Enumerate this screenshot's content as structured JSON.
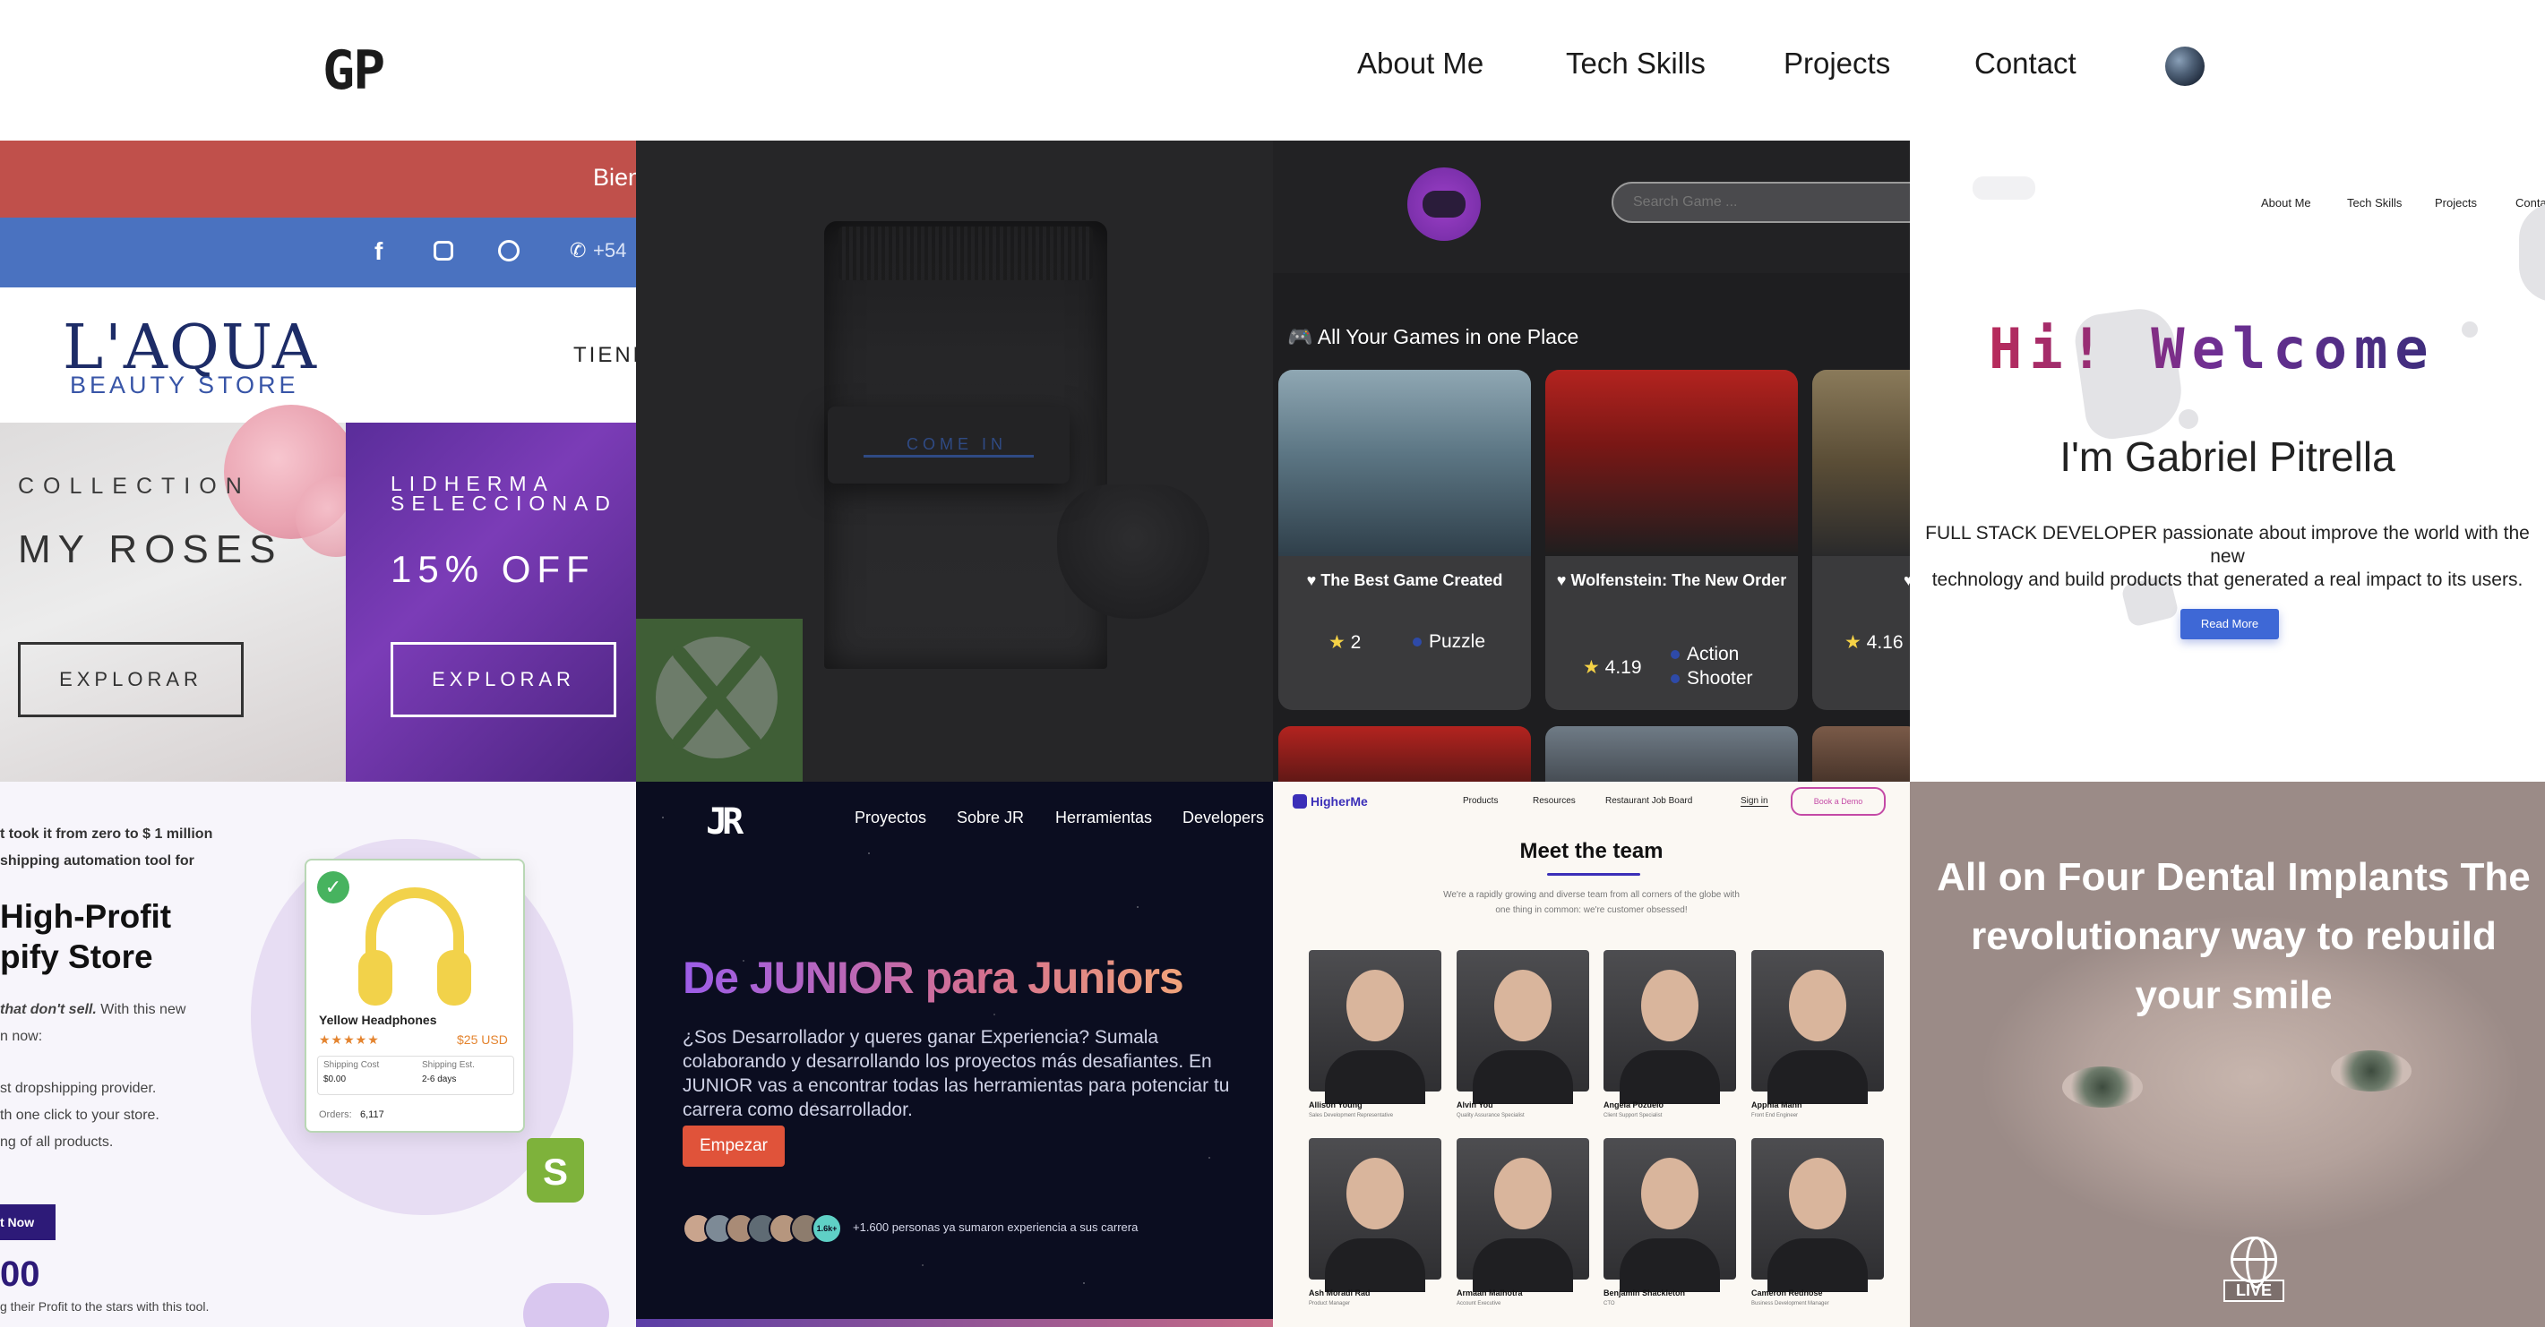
{
  "header": {
    "logo": "GP",
    "nav": [
      "About Me",
      "Tech Skills",
      "Projects",
      "Contact"
    ],
    "theme_icon": "moon-icon"
  },
  "tiles": {
    "laqua": {
      "banner": "Bien",
      "phone": "+54",
      "brand": "L'AQUA",
      "brand_sub": "BEAUTY STORE",
      "menu": "TIEND",
      "collection_label": "COLLECTION",
      "collection_title": "MY ROSES",
      "promo_label": "LIDHERMA SELECCIONAD",
      "promo_title": "15% OFF",
      "button_left": "EXPLORAR",
      "button_right": "EXPLORAR"
    },
    "xbox": {
      "button": "COME IN"
    },
    "games": {
      "search_placeholder": "Search Game ...",
      "section_title": "🎮 All Your Games in one Place",
      "cards": [
        {
          "title": "The Best Game Created",
          "rating": "2",
          "genres": [
            "Puzzle"
          ]
        },
        {
          "title": "Wolfenstein: The New Order",
          "rating": "4.19",
          "genres": [
            "Action",
            "Shooter"
          ]
        },
        {
          "title": "",
          "rating": "4.16",
          "genres": []
        }
      ]
    },
    "portfolio": {
      "nav": [
        "About Me",
        "Tech Skills",
        "Projects",
        "Conta"
      ],
      "greeting": "Hi! Welcome",
      "name": "I'm Gabriel Pitrella",
      "description_line1": "FULL STACK DEVELOPER passionate about improve the world with the new",
      "description_line2": "technology and build products that generated a real impact to its users.",
      "button": "Read More"
    },
    "shopify": {
      "intro_line1": "t took it from zero to $ 1 million",
      "intro_line2": "shipping automation tool for",
      "heading_line1": "High-Profit",
      "heading_line2": "pify Store",
      "body_emph": "that don't sell.",
      "body_rest": "With this new",
      "body_line2": "n now:",
      "list": [
        "st dropshipping provider.",
        "th one click to your store.",
        "ng of all products."
      ],
      "product_name": "Yellow Headphones",
      "product_price": "$25 USD",
      "shipping_cost_label": "Shipping Cost",
      "shipping_cost_value": "$0.00",
      "shipping_est_label": "Shipping Est.",
      "shipping_est_value": "2-6 days",
      "orders_label": "Orders:",
      "orders_value": "6,117",
      "cta": "t Now",
      "big_number": "00",
      "footer_text": "g their Profit to the stars with this tool."
    },
    "junior": {
      "nav": [
        "Proyectos",
        "Sobre JR",
        "Herramientas",
        "Developers"
      ],
      "heading": "De JUNIOR para Juniors",
      "body": "¿Sos Desarrollador y queres ganar Experiencia? Sumala colaborando y desarrollando los proyectos más desafiantes. En JUNIOR vas a encontrar todas las herramientas para potenciar tu carrera como desarrollador.",
      "button": "Empezar",
      "avatar_badge": "1.6k+",
      "members_text": "+1.600 personas ya sumaron experiencia a sus carrera"
    },
    "higherme": {
      "brand": "HigherMe",
      "nav": [
        "Products",
        "Resources",
        "Restaurant Job Board",
        "Sign in"
      ],
      "demo": "Book a Demo",
      "heading": "Meet the team",
      "subtitle_line1": "We're a rapidly growing and diverse team from all corners of the globe with",
      "subtitle_line2": "one thing in common: we're customer obsessed!",
      "team": [
        {
          "name": "Allison Young",
          "role": "Sales Development Representative"
        },
        {
          "name": "Alvin You",
          "role": "Quality Assurance Specialist"
        },
        {
          "name": "Angela Pozuelo",
          "role": "Client Support Specialist"
        },
        {
          "name": "Apphia Mann",
          "role": "Front End Engineer"
        },
        {
          "name": "Ash Moradi Rad",
          "role": "Product Manager"
        },
        {
          "name": "Armaan Malhotra",
          "role": "Account Executive"
        },
        {
          "name": "Benjamin Shackleton",
          "role": "CTO"
        },
        {
          "name": "Cameron Rednose",
          "role": "Business Development Manager"
        }
      ]
    },
    "dental": {
      "heading_line1": "All on Four Dental Implants The",
      "heading_line2": "revolutionary way to rebuild",
      "heading_line3": "your smile",
      "live": "LIVE"
    }
  }
}
